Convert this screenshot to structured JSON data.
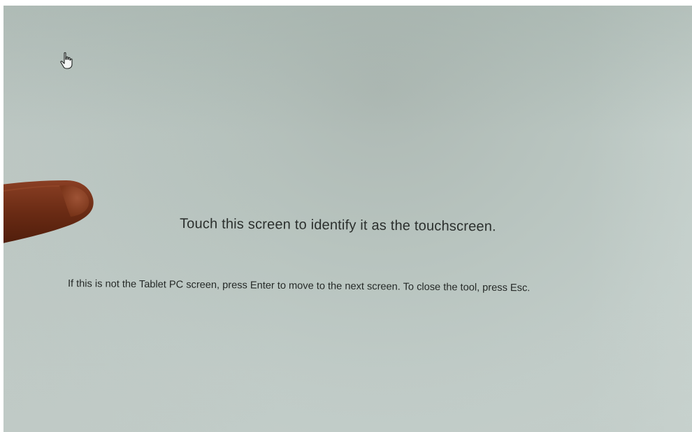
{
  "screen": {
    "background_color": "#b9c5c0",
    "heading": "Touch this screen to identify it as the touchscreen.",
    "instructions": "If this is not the Tablet PC screen, press Enter to move to the next screen. To close the tool, press Esc.",
    "cursor_icon": "hand-pointer-icon",
    "finger": "finger-touching-screen"
  }
}
